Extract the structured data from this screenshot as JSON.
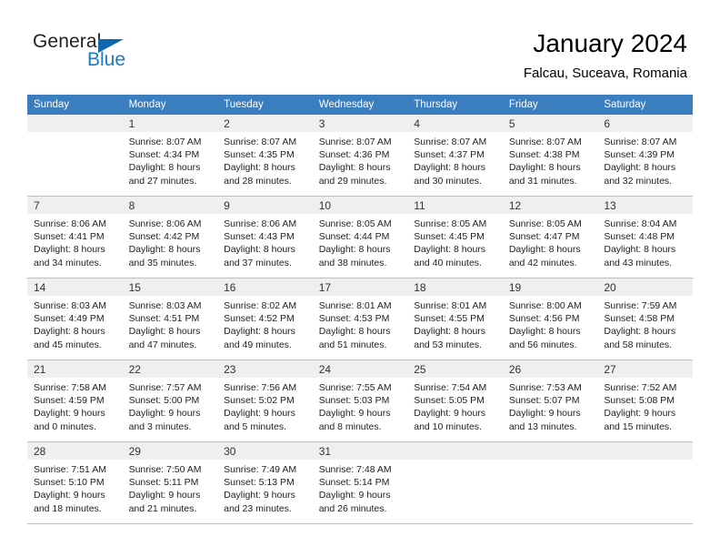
{
  "brand": {
    "word_one": "General",
    "word_two": "Blue",
    "triangle_color": "#1166b0",
    "blue_color": "#1a7bc4"
  },
  "header": {
    "title": "January 2024",
    "location": "Falcau, Suceava, Romania"
  },
  "theme": {
    "header_row_bg": "#3a7ebf",
    "header_row_text": "#ffffff",
    "daynum_bg": "#efefef",
    "grid_line": "#bfbfbf"
  },
  "weekdays": [
    "Sunday",
    "Monday",
    "Tuesday",
    "Wednesday",
    "Thursday",
    "Friday",
    "Saturday"
  ],
  "labels": {
    "sunrise_prefix": "Sunrise:",
    "sunset_prefix": "Sunset:",
    "daylight_prefix": "Daylight:"
  },
  "weeks": [
    {
      "days": [
        {
          "num": "",
          "sunrise": "",
          "sunset": "",
          "daylight_1": "",
          "daylight_2": "",
          "empty": true
        },
        {
          "num": "1",
          "sunrise": "Sunrise: 8:07 AM",
          "sunset": "Sunset: 4:34 PM",
          "daylight_1": "Daylight: 8 hours",
          "daylight_2": "and 27 minutes.",
          "empty": false
        },
        {
          "num": "2",
          "sunrise": "Sunrise: 8:07 AM",
          "sunset": "Sunset: 4:35 PM",
          "daylight_1": "Daylight: 8 hours",
          "daylight_2": "and 28 minutes.",
          "empty": false
        },
        {
          "num": "3",
          "sunrise": "Sunrise: 8:07 AM",
          "sunset": "Sunset: 4:36 PM",
          "daylight_1": "Daylight: 8 hours",
          "daylight_2": "and 29 minutes.",
          "empty": false
        },
        {
          "num": "4",
          "sunrise": "Sunrise: 8:07 AM",
          "sunset": "Sunset: 4:37 PM",
          "daylight_1": "Daylight: 8 hours",
          "daylight_2": "and 30 minutes.",
          "empty": false
        },
        {
          "num": "5",
          "sunrise": "Sunrise: 8:07 AM",
          "sunset": "Sunset: 4:38 PM",
          "daylight_1": "Daylight: 8 hours",
          "daylight_2": "and 31 minutes.",
          "empty": false
        },
        {
          "num": "6",
          "sunrise": "Sunrise: 8:07 AM",
          "sunset": "Sunset: 4:39 PM",
          "daylight_1": "Daylight: 8 hours",
          "daylight_2": "and 32 minutes.",
          "empty": false
        }
      ]
    },
    {
      "days": [
        {
          "num": "7",
          "sunrise": "Sunrise: 8:06 AM",
          "sunset": "Sunset: 4:41 PM",
          "daylight_1": "Daylight: 8 hours",
          "daylight_2": "and 34 minutes.",
          "empty": false
        },
        {
          "num": "8",
          "sunrise": "Sunrise: 8:06 AM",
          "sunset": "Sunset: 4:42 PM",
          "daylight_1": "Daylight: 8 hours",
          "daylight_2": "and 35 minutes.",
          "empty": false
        },
        {
          "num": "9",
          "sunrise": "Sunrise: 8:06 AM",
          "sunset": "Sunset: 4:43 PM",
          "daylight_1": "Daylight: 8 hours",
          "daylight_2": "and 37 minutes.",
          "empty": false
        },
        {
          "num": "10",
          "sunrise": "Sunrise: 8:05 AM",
          "sunset": "Sunset: 4:44 PM",
          "daylight_1": "Daylight: 8 hours",
          "daylight_2": "and 38 minutes.",
          "empty": false
        },
        {
          "num": "11",
          "sunrise": "Sunrise: 8:05 AM",
          "sunset": "Sunset: 4:45 PM",
          "daylight_1": "Daylight: 8 hours",
          "daylight_2": "and 40 minutes.",
          "empty": false
        },
        {
          "num": "12",
          "sunrise": "Sunrise: 8:05 AM",
          "sunset": "Sunset: 4:47 PM",
          "daylight_1": "Daylight: 8 hours",
          "daylight_2": "and 42 minutes.",
          "empty": false
        },
        {
          "num": "13",
          "sunrise": "Sunrise: 8:04 AM",
          "sunset": "Sunset: 4:48 PM",
          "daylight_1": "Daylight: 8 hours",
          "daylight_2": "and 43 minutes.",
          "empty": false
        }
      ]
    },
    {
      "days": [
        {
          "num": "14",
          "sunrise": "Sunrise: 8:03 AM",
          "sunset": "Sunset: 4:49 PM",
          "daylight_1": "Daylight: 8 hours",
          "daylight_2": "and 45 minutes.",
          "empty": false
        },
        {
          "num": "15",
          "sunrise": "Sunrise: 8:03 AM",
          "sunset": "Sunset: 4:51 PM",
          "daylight_1": "Daylight: 8 hours",
          "daylight_2": "and 47 minutes.",
          "empty": false
        },
        {
          "num": "16",
          "sunrise": "Sunrise: 8:02 AM",
          "sunset": "Sunset: 4:52 PM",
          "daylight_1": "Daylight: 8 hours",
          "daylight_2": "and 49 minutes.",
          "empty": false
        },
        {
          "num": "17",
          "sunrise": "Sunrise: 8:01 AM",
          "sunset": "Sunset: 4:53 PM",
          "daylight_1": "Daylight: 8 hours",
          "daylight_2": "and 51 minutes.",
          "empty": false
        },
        {
          "num": "18",
          "sunrise": "Sunrise: 8:01 AM",
          "sunset": "Sunset: 4:55 PM",
          "daylight_1": "Daylight: 8 hours",
          "daylight_2": "and 53 minutes.",
          "empty": false
        },
        {
          "num": "19",
          "sunrise": "Sunrise: 8:00 AM",
          "sunset": "Sunset: 4:56 PM",
          "daylight_1": "Daylight: 8 hours",
          "daylight_2": "and 56 minutes.",
          "empty": false
        },
        {
          "num": "20",
          "sunrise": "Sunrise: 7:59 AM",
          "sunset": "Sunset: 4:58 PM",
          "daylight_1": "Daylight: 8 hours",
          "daylight_2": "and 58 minutes.",
          "empty": false
        }
      ]
    },
    {
      "days": [
        {
          "num": "21",
          "sunrise": "Sunrise: 7:58 AM",
          "sunset": "Sunset: 4:59 PM",
          "daylight_1": "Daylight: 9 hours",
          "daylight_2": "and 0 minutes.",
          "empty": false
        },
        {
          "num": "22",
          "sunrise": "Sunrise: 7:57 AM",
          "sunset": "Sunset: 5:00 PM",
          "daylight_1": "Daylight: 9 hours",
          "daylight_2": "and 3 minutes.",
          "empty": false
        },
        {
          "num": "23",
          "sunrise": "Sunrise: 7:56 AM",
          "sunset": "Sunset: 5:02 PM",
          "daylight_1": "Daylight: 9 hours",
          "daylight_2": "and 5 minutes.",
          "empty": false
        },
        {
          "num": "24",
          "sunrise": "Sunrise: 7:55 AM",
          "sunset": "Sunset: 5:03 PM",
          "daylight_1": "Daylight: 9 hours",
          "daylight_2": "and 8 minutes.",
          "empty": false
        },
        {
          "num": "25",
          "sunrise": "Sunrise: 7:54 AM",
          "sunset": "Sunset: 5:05 PM",
          "daylight_1": "Daylight: 9 hours",
          "daylight_2": "and 10 minutes.",
          "empty": false
        },
        {
          "num": "26",
          "sunrise": "Sunrise: 7:53 AM",
          "sunset": "Sunset: 5:07 PM",
          "daylight_1": "Daylight: 9 hours",
          "daylight_2": "and 13 minutes.",
          "empty": false
        },
        {
          "num": "27",
          "sunrise": "Sunrise: 7:52 AM",
          "sunset": "Sunset: 5:08 PM",
          "daylight_1": "Daylight: 9 hours",
          "daylight_2": "and 15 minutes.",
          "empty": false
        }
      ]
    },
    {
      "days": [
        {
          "num": "28",
          "sunrise": "Sunrise: 7:51 AM",
          "sunset": "Sunset: 5:10 PM",
          "daylight_1": "Daylight: 9 hours",
          "daylight_2": "and 18 minutes.",
          "empty": false
        },
        {
          "num": "29",
          "sunrise": "Sunrise: 7:50 AM",
          "sunset": "Sunset: 5:11 PM",
          "daylight_1": "Daylight: 9 hours",
          "daylight_2": "and 21 minutes.",
          "empty": false
        },
        {
          "num": "30",
          "sunrise": "Sunrise: 7:49 AM",
          "sunset": "Sunset: 5:13 PM",
          "daylight_1": "Daylight: 9 hours",
          "daylight_2": "and 23 minutes.",
          "empty": false
        },
        {
          "num": "31",
          "sunrise": "Sunrise: 7:48 AM",
          "sunset": "Sunset: 5:14 PM",
          "daylight_1": "Daylight: 9 hours",
          "daylight_2": "and 26 minutes.",
          "empty": false
        },
        {
          "num": "",
          "sunrise": "",
          "sunset": "",
          "daylight_1": "",
          "daylight_2": "",
          "empty": true
        },
        {
          "num": "",
          "sunrise": "",
          "sunset": "",
          "daylight_1": "",
          "daylight_2": "",
          "empty": true
        },
        {
          "num": "",
          "sunrise": "",
          "sunset": "",
          "daylight_1": "",
          "daylight_2": "",
          "empty": true
        }
      ]
    }
  ]
}
